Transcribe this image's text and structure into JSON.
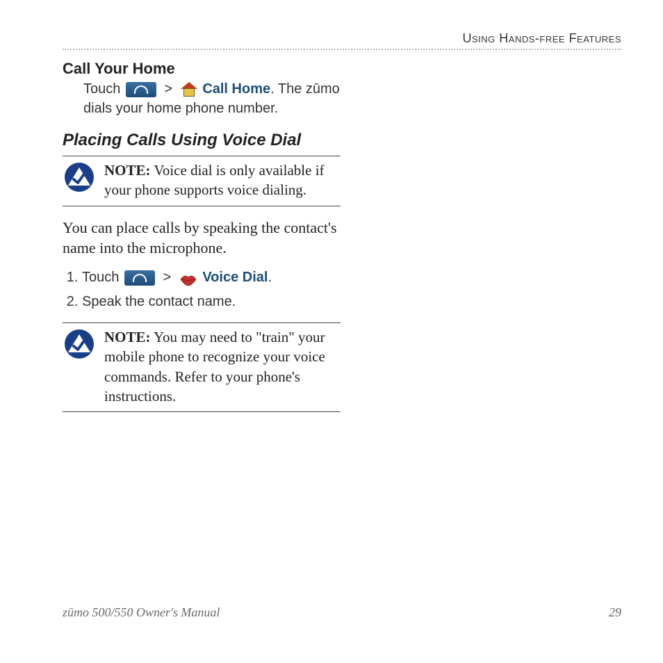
{
  "header": {
    "running_head": "Using Hands-free Features"
  },
  "section1": {
    "heading": "Call Your Home",
    "touch_word": "Touch ",
    "call_home_label": "Call Home",
    "tail": ". The zūmo dials your home phone number.",
    "gt": ">"
  },
  "section2": {
    "heading": "Placing Calls Using Voice Dial",
    "note1_label": "NOTE:",
    "note1_text": " Voice dial is only available if your phone supports voice dialing.",
    "para": "You can place calls by speaking the contact's name into the microphone.",
    "step1_touch": "Touch ",
    "step1_gt": ">",
    "step1_label": "Voice Dial",
    "step1_tail": ".",
    "step2": "Speak the contact name.",
    "note2_label": "NOTE:",
    "note2_text": " You may need to \"train\" your mobile phone to recognize your voice commands. Refer to your phone's instructions."
  },
  "footer": {
    "manual": "zūmo 500/550 Owner's Manual",
    "page": "29"
  }
}
